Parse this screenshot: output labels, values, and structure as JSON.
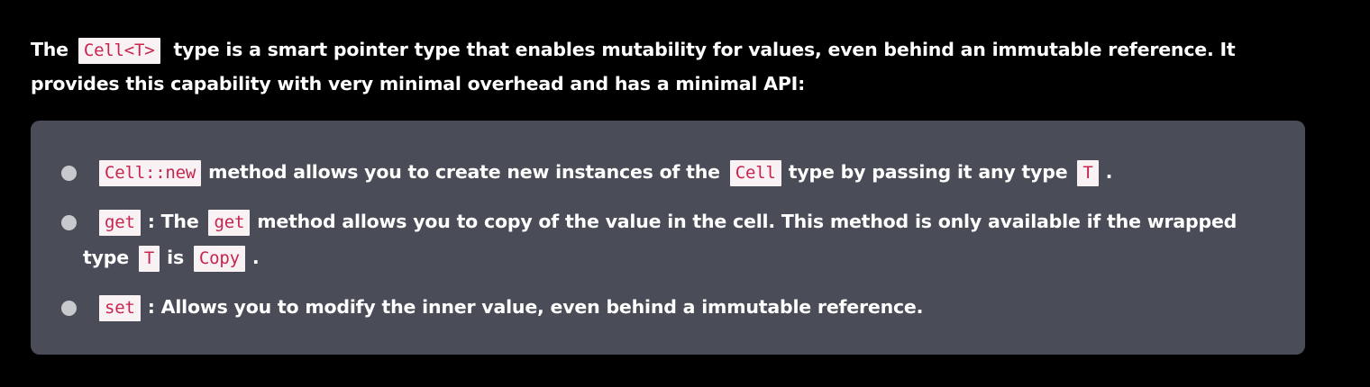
{
  "intro": {
    "word_the": "The",
    "code_cell_t": "Cell<T>",
    "rest_1": "type is a smart pointer type that enables mutability for values, even behind an immutable reference. It provides this capability with very minimal overhead and has a minimal API:"
  },
  "api_list": {
    "items": [
      {
        "code_a": "Cell::new",
        "text_a": "method allows you to create new instances of the",
        "code_b": "Cell",
        "text_b": "type by passing it any type",
        "code_c": "T",
        "text_c": "."
      },
      {
        "code_a": "get",
        "text_a": ": The",
        "code_b": "get",
        "text_b": "method allows you to copy of the value in the cell. This method is only available if the wrapped type",
        "code_c": "T",
        "text_c": "is",
        "code_d": "Copy",
        "text_d": "."
      },
      {
        "code_a": "set",
        "text_a": ": Allows you to modify the inner value, even behind a immutable reference."
      }
    ]
  },
  "colors": {
    "page_background": "#000000",
    "panel_background": "#4a4d57",
    "code_text": "#c7254e",
    "code_background": "#f9f2f4",
    "bullet": "#c8c9cd"
  }
}
